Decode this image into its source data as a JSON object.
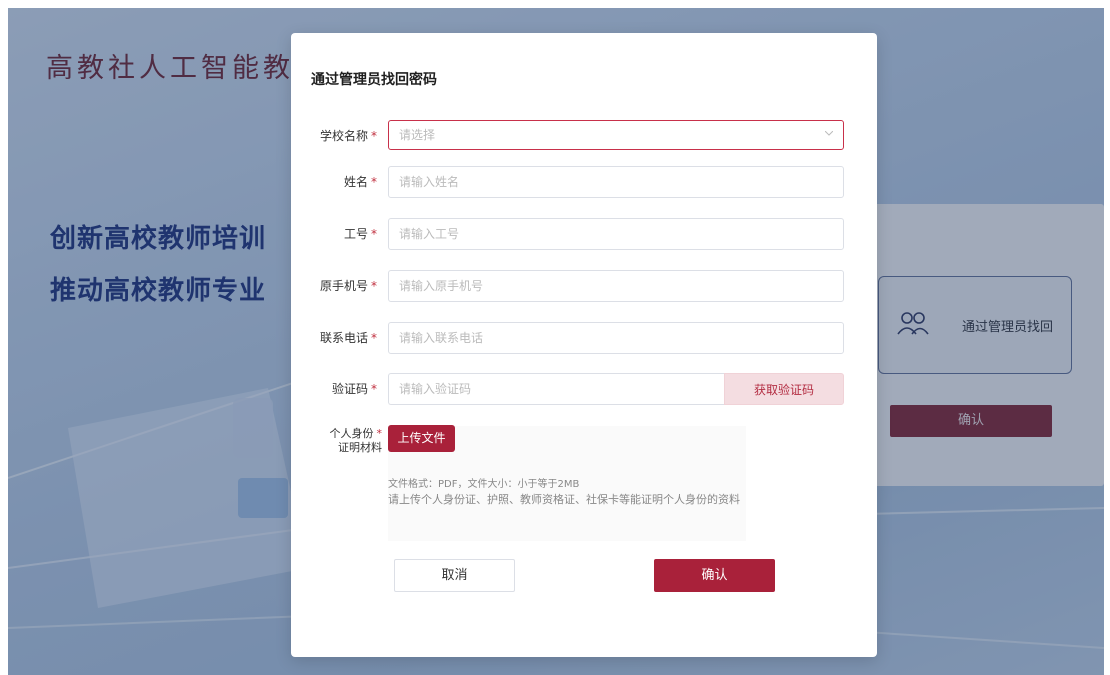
{
  "background": {
    "brand_text": "高教社人工智能教学",
    "slogan_line1": "创新高校教师培训",
    "slogan_line2": "推动高校教师专业"
  },
  "right_panel": {
    "method_label": "通过管理员找回",
    "method_icon": "users-icon",
    "confirm_label": "确认"
  },
  "modal": {
    "title": "通过管理员找回密码",
    "fields": {
      "school": {
        "label": "学校名称",
        "placeholder": "请选择"
      },
      "name": {
        "label": "姓名",
        "placeholder": "请输入姓名"
      },
      "employee_id": {
        "label": "工号",
        "placeholder": "请输入工号"
      },
      "orig_phone": {
        "label": "原手机号",
        "placeholder": "请输入原手机号"
      },
      "contact_phone": {
        "label": "联系电话",
        "placeholder": "请输入联系电话"
      },
      "code": {
        "label": "验证码",
        "placeholder": "请输入验证码",
        "button": "获取验证码"
      },
      "id_docs": {
        "label_line1": "个人身份",
        "label_line2": "证明材料",
        "upload_button": "上传文件",
        "hint_format": "文件格式：PDF，文件大小：小于等于2MB",
        "hint_desc": "请上传个人身份证、护照、教师资格证、社保卡等能证明个人身份的资料"
      }
    },
    "required_mark": "*",
    "cancel_label": "取消",
    "confirm_label": "确认"
  },
  "colors": {
    "primary": "#a9213a",
    "primary_light": "#f4dde1",
    "slogan": "#1b2f7a"
  }
}
